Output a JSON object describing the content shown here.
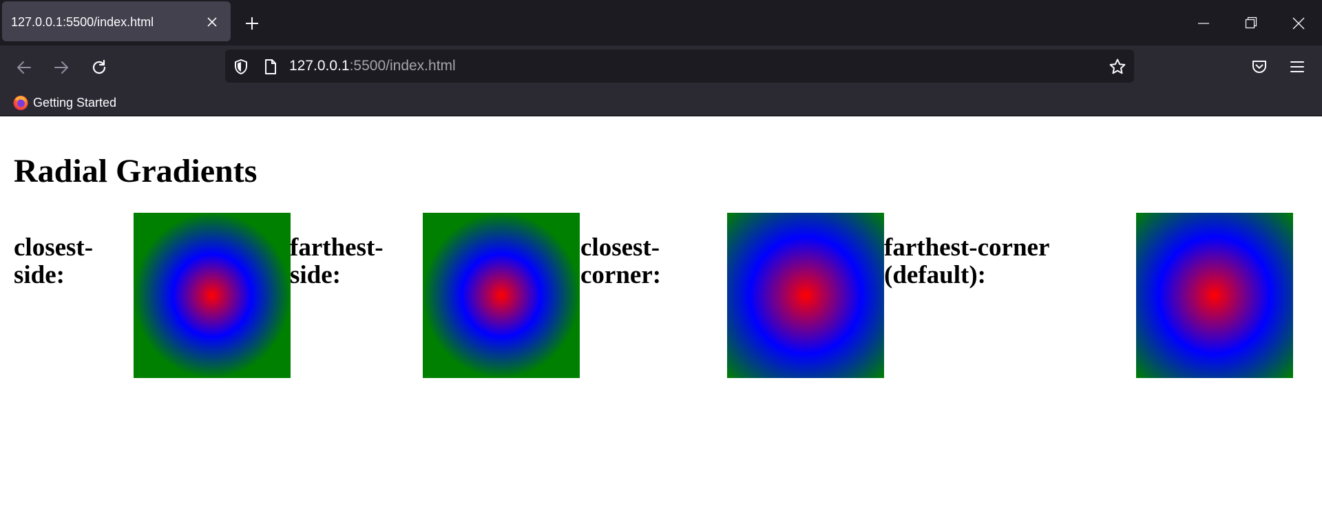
{
  "browser": {
    "tab": {
      "title": "127.0.0.1:5500/index.html"
    },
    "address": {
      "host": "127.0.0.1",
      "rest": ":5500/index.html"
    },
    "bookmarks": [
      {
        "label": "Getting Started",
        "icon": "firefox-icon"
      }
    ],
    "icons": {
      "tab_close": "close-icon",
      "new_tab": "plus-icon",
      "back": "arrow-left-icon",
      "forward": "arrow-right-icon",
      "reload": "reload-icon",
      "shield": "shield-icon",
      "page": "page-icon",
      "bookmark_star": "star-icon",
      "pocket": "pocket-icon",
      "menu": "hamburger-menu-icon"
    }
  },
  "page": {
    "title": "Radial Gradients",
    "examples": [
      {
        "label": "closest-side:",
        "shape": "closest-side",
        "colors": [
          "#ff0000",
          "#0000ff",
          "#008000"
        ]
      },
      {
        "label": "farthest-side:",
        "shape": "farthest-side",
        "colors": [
          "#ff0000",
          "#0000ff",
          "#008000"
        ]
      },
      {
        "label": "closest-corner:",
        "shape": "closest-corner",
        "colors": [
          "#ff0000",
          "#0000ff",
          "#008000"
        ]
      },
      {
        "label": "farthest-corner (default):",
        "shape": "farthest-corner",
        "colors": [
          "#ff0000",
          "#0000ff",
          "#008000"
        ]
      }
    ]
  }
}
